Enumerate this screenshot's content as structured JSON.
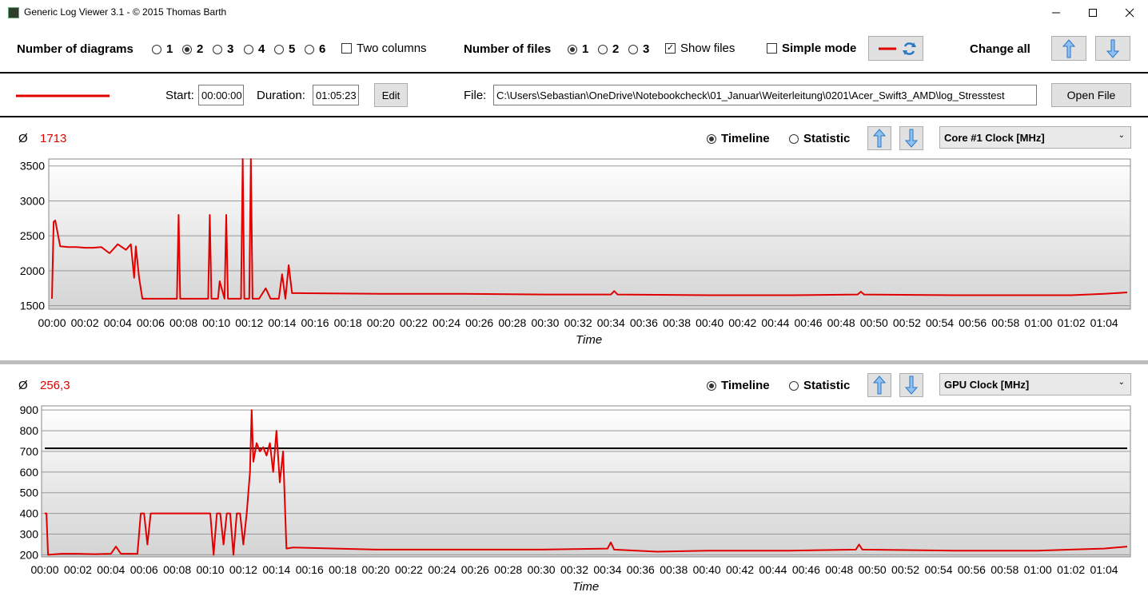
{
  "window": {
    "title": "Generic Log Viewer 3.1 - © 2015 Thomas Barth"
  },
  "toolbar": {
    "num_diagrams_label": "Number of diagrams",
    "diagram_options": [
      "1",
      "2",
      "3",
      "4",
      "5",
      "6"
    ],
    "diagram_selected": "2",
    "two_columns_label": "Two columns",
    "two_columns_checked": false,
    "num_files_label": "Number of files",
    "file_options": [
      "1",
      "2",
      "3"
    ],
    "files_selected": "1",
    "show_files_label": "Show files",
    "show_files_checked": true,
    "simple_mode_label": "Simple mode",
    "simple_mode_checked": false,
    "change_all_label": "Change all"
  },
  "file_row": {
    "line_color": "#e00000",
    "start_label": "Start:",
    "start_value": "00:00:00",
    "duration_label": "Duration:",
    "duration_value": "01:05:23",
    "edit_label": "Edit",
    "file_label": "File:",
    "file_path": "C:\\Users\\Sebastian\\OneDrive\\Notebookcheck\\01_Januar\\Weiterleitung\\0201\\Acer_Swift3_AMD\\log_Stresstest",
    "open_file_label": "Open File"
  },
  "diagrams": [
    {
      "avg_symbol": "Ø",
      "avg_value": "1713",
      "timeline_label": "Timeline",
      "statistic_label": "Statistic",
      "mode": "Timeline",
      "sensor": "Core #1 Clock [MHz]",
      "x_title": "Time"
    },
    {
      "avg_symbol": "Ø",
      "avg_value": "256,3",
      "timeline_label": "Timeline",
      "statistic_label": "Statistic",
      "mode": "Timeline",
      "sensor": "GPU Clock [MHz]",
      "x_title": "Time"
    }
  ],
  "chart_data": [
    {
      "type": "line",
      "title": "",
      "xlabel": "Time",
      "ylabel": "",
      "ylim": [
        1450,
        3600
      ],
      "y_ticks": [
        "3500",
        "3000",
        "2500",
        "2000",
        "1500"
      ],
      "x_ticks": [
        "00:00",
        "00:02",
        "00:04",
        "00:06",
        "00:08",
        "00:10",
        "00:12",
        "00:14",
        "00:16",
        "00:18",
        "00:20",
        "00:22",
        "00:24",
        "00:26",
        "00:28",
        "00:30",
        "00:32",
        "00:34",
        "00:36",
        "00:38",
        "00:40",
        "00:42",
        "00:44",
        "00:46",
        "00:48",
        "00:50",
        "00:52",
        "00:54",
        "00:56",
        "00:58",
        "01:00",
        "01:02",
        "01:04"
      ],
      "series": [
        {
          "color": "#e00000",
          "x": [
            0.0,
            0.1,
            0.2,
            0.5,
            1.0,
            1.5,
            2.0,
            2.5,
            3.0,
            3.5,
            4.0,
            4.5,
            4.8,
            5.0,
            5.1,
            5.3,
            5.5,
            5.8,
            6.2,
            6.8,
            7.2,
            7.6,
            7.7,
            7.8,
            8.5,
            9.0,
            9.5,
            9.6,
            9.7,
            10.0,
            10.1,
            10.2,
            10.5,
            10.6,
            10.7,
            11.0,
            11.5,
            11.6,
            11.7,
            12.0,
            12.1,
            12.2,
            12.6,
            13.0,
            13.3,
            13.5,
            13.7,
            13.8,
            14.0,
            14.2,
            14.4,
            14.6,
            15.0,
            20.0,
            25.0,
            30.0,
            34.0,
            34.2,
            34.4,
            40.0,
            45.0,
            49.0,
            49.2,
            49.4,
            55.0,
            60.0,
            62.0,
            64.0,
            65.4
          ],
          "y": [
            1600,
            2700,
            2720,
            2350,
            2340,
            2340,
            2330,
            2330,
            2340,
            2250,
            2380,
            2300,
            2380,
            1900,
            2350,
            1900,
            1600,
            1600,
            1600,
            1600,
            1600,
            1600,
            2800,
            1600,
            1600,
            1600,
            1600,
            2800,
            1600,
            1600,
            1600,
            1850,
            1600,
            2800,
            1600,
            1600,
            1600,
            3600,
            1600,
            1600,
            3600,
            1600,
            1600,
            1750,
            1600,
            1600,
            1600,
            1600,
            1950,
            1600,
            2080,
            1680,
            1680,
            1670,
            1670,
            1660,
            1660,
            1710,
            1660,
            1650,
            1650,
            1660,
            1700,
            1660,
            1650,
            1650,
            1650,
            1670,
            1690
          ]
        }
      ]
    },
    {
      "type": "line",
      "title": "",
      "xlabel": "Time",
      "ylabel": "",
      "ylim": [
        190,
        920
      ],
      "y_ticks": [
        "900",
        "800",
        "700",
        "600",
        "500",
        "400",
        "300",
        "200"
      ],
      "x_ticks": [
        "00:00",
        "00:02",
        "00:04",
        "00:06",
        "00:08",
        "00:10",
        "00:12",
        "00:14",
        "00:16",
        "00:18",
        "00:20",
        "00:22",
        "00:24",
        "00:26",
        "00:28",
        "00:30",
        "00:32",
        "00:34",
        "00:36",
        "00:38",
        "00:40",
        "00:42",
        "00:44",
        "00:46",
        "00:48",
        "00:50",
        "00:52",
        "00:54",
        "00:56",
        "00:58",
        "01:00",
        "01:02",
        "01:04"
      ],
      "reference_line": 715,
      "series": [
        {
          "color": "#e00000",
          "x": [
            0.0,
            0.1,
            0.2,
            1.0,
            2.0,
            3.0,
            4.0,
            4.3,
            4.6,
            5.0,
            5.6,
            5.8,
            6.0,
            6.2,
            6.4,
            6.6,
            7.0,
            8.0,
            9.0,
            10.0,
            10.2,
            10.4,
            10.6,
            10.8,
            11.0,
            11.2,
            11.4,
            11.6,
            11.8,
            12.0,
            12.2,
            12.4,
            12.5,
            12.6,
            12.8,
            13.0,
            13.2,
            13.4,
            13.6,
            13.8,
            14.0,
            14.2,
            14.4,
            14.6,
            15.0,
            20.0,
            25.0,
            30.0,
            34.0,
            34.2,
            34.4,
            37.0,
            40.0,
            45.0,
            49.0,
            49.2,
            49.4,
            55.0,
            60.0,
            62.0,
            64.0,
            65.4
          ],
          "y": [
            400,
            400,
            200,
            205,
            205,
            203,
            205,
            240,
            205,
            205,
            205,
            400,
            400,
            250,
            400,
            400,
            400,
            400,
            400,
            400,
            200,
            400,
            400,
            250,
            400,
            400,
            200,
            400,
            400,
            250,
            400,
            600,
            900,
            650,
            740,
            700,
            720,
            680,
            740,
            600,
            800,
            550,
            700,
            230,
            235,
            225,
            225,
            225,
            230,
            260,
            225,
            215,
            220,
            220,
            225,
            250,
            225,
            220,
            220,
            225,
            230,
            240
          ]
        }
      ]
    }
  ]
}
